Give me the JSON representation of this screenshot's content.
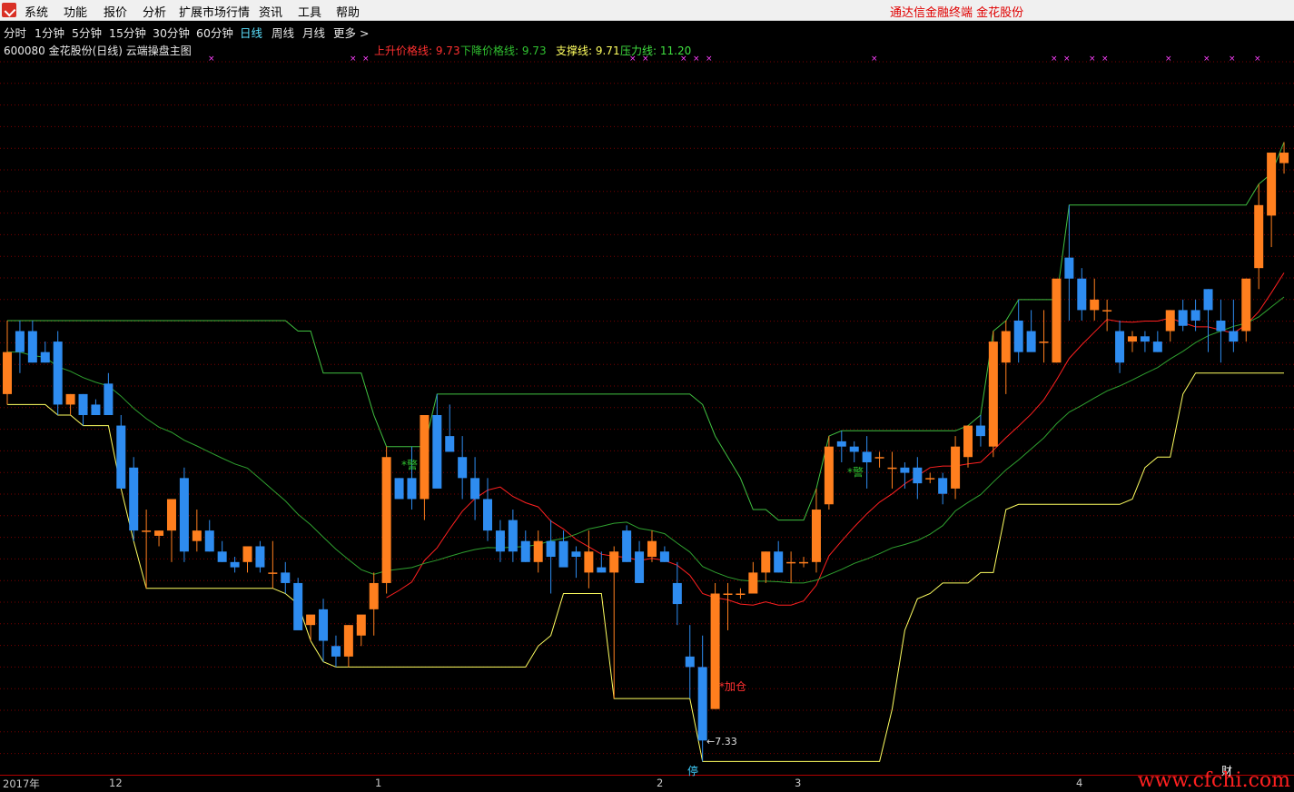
{
  "menubar": {
    "items": [
      "系统",
      "功能",
      "报价",
      "分析",
      "扩展市场行情",
      "资讯",
      "工具",
      "帮助"
    ],
    "brand": "通达信金融终端   金花股份"
  },
  "timeframes": {
    "items": [
      "分时",
      "1分钟",
      "5分钟",
      "15分钟",
      "30分钟",
      "60分钟",
      "日线",
      "周线",
      "月线",
      "更多 >"
    ],
    "active_index": 6
  },
  "info": {
    "title": "600080 金花股份(日线) 云端操盘主图",
    "up_label": "上升价格线: 9.73",
    "down_label": "下降价格线: 9.73",
    "support_label": "支撑线: 9.71",
    "pressure_label": "压力线: 11.20"
  },
  "annotations": {
    "warn1": "*警",
    "warn2": "*警",
    "add_position": "*加仓",
    "low_price": "←7.33",
    "limit_marker": "停",
    "fin_marker": "财"
  },
  "axis_labels": [
    "2017年",
    "12",
    "1",
    "2",
    "3",
    "4"
  ],
  "watermark": "www.cfchi.com",
  "colors": {
    "up_candle": "#ff7f1e",
    "down_candle": "#2e8cf0",
    "support_line": "#ffff60",
    "pressure_line": "#40c040",
    "ma_red": "#ff2020",
    "grid": "#7a0000"
  },
  "chart_data": {
    "type": "candlestick",
    "price_range": [
      7.0,
      13.0
    ],
    "candles": [
      {
        "o": 9.8,
        "h": 10.5,
        "l": 9.7,
        "c": 10.2
      },
      {
        "o": 10.4,
        "h": 10.5,
        "l": 10.0,
        "c": 10.2
      },
      {
        "o": 10.4,
        "h": 10.5,
        "l": 10.1,
        "c": 10.1
      },
      {
        "o": 10.2,
        "h": 10.3,
        "l": 10.1,
        "c": 10.1
      },
      {
        "o": 10.3,
        "h": 10.4,
        "l": 9.6,
        "c": 9.7
      },
      {
        "o": 9.7,
        "h": 9.8,
        "l": 9.6,
        "c": 9.8
      },
      {
        "o": 9.8,
        "h": 9.8,
        "l": 9.5,
        "c": 9.6
      },
      {
        "o": 9.7,
        "h": 9.75,
        "l": 9.6,
        "c": 9.6
      },
      {
        "o": 9.9,
        "h": 10.0,
        "l": 9.6,
        "c": 9.6
      },
      {
        "o": 9.5,
        "h": 9.6,
        "l": 8.9,
        "c": 8.9
      },
      {
        "o": 9.1,
        "h": 9.2,
        "l": 8.4,
        "c": 8.5
      },
      {
        "o": 8.5,
        "h": 8.7,
        "l": 7.95,
        "c": 8.5
      },
      {
        "o": 8.45,
        "h": 8.5,
        "l": 8.35,
        "c": 8.5
      },
      {
        "o": 8.5,
        "h": 8.7,
        "l": 8.2,
        "c": 8.8
      },
      {
        "o": 9.0,
        "h": 9.1,
        "l": 8.2,
        "c": 8.3
      },
      {
        "o": 8.4,
        "h": 8.7,
        "l": 8.3,
        "c": 8.5
      },
      {
        "o": 8.5,
        "h": 8.6,
        "l": 8.3,
        "c": 8.3
      },
      {
        "o": 8.3,
        "h": 8.4,
        "l": 8.2,
        "c": 8.2
      },
      {
        "o": 8.2,
        "h": 8.25,
        "l": 8.1,
        "c": 8.15
      },
      {
        "o": 8.2,
        "h": 8.35,
        "l": 8.1,
        "c": 8.35
      },
      {
        "o": 8.35,
        "h": 8.4,
        "l": 8.1,
        "c": 8.15
      },
      {
        "o": 8.1,
        "h": 8.4,
        "l": 7.95,
        "c": 8.1
      },
      {
        "o": 8.1,
        "h": 8.2,
        "l": 7.9,
        "c": 8.0
      },
      {
        "o": 8.0,
        "h": 8.05,
        "l": 7.8,
        "c": 7.55
      },
      {
        "o": 7.6,
        "h": 7.65,
        "l": 7.45,
        "c": 7.7
      },
      {
        "o": 7.75,
        "h": 7.85,
        "l": 7.25,
        "c": 7.45
      },
      {
        "o": 7.4,
        "h": 7.5,
        "l": 7.2,
        "c": 7.3
      },
      {
        "o": 7.3,
        "h": 7.6,
        "l": 7.2,
        "c": 7.6
      },
      {
        "o": 7.5,
        "h": 7.65,
        "l": 7.4,
        "c": 7.7
      },
      {
        "o": 7.75,
        "h": 8.1,
        "l": 7.5,
        "c": 8.0
      },
      {
        "o": 8.0,
        "h": 9.3,
        "l": 7.9,
        "c": 9.2
      },
      {
        "o": 9.0,
        "h": 9.0,
        "l": 8.8,
        "c": 8.8
      },
      {
        "o": 9.0,
        "h": 9.3,
        "l": 8.7,
        "c": 8.8
      },
      {
        "o": 8.8,
        "h": 9.0,
        "l": 8.6,
        "c": 9.6
      },
      {
        "o": 9.6,
        "h": 9.8,
        "l": 9.0,
        "c": 8.9
      },
      {
        "o": 9.4,
        "h": 9.7,
        "l": 9.3,
        "c": 9.25
      },
      {
        "o": 9.2,
        "h": 9.4,
        "l": 8.8,
        "c": 9.0
      },
      {
        "o": 9.0,
        "h": 9.2,
        "l": 8.6,
        "c": 8.8
      },
      {
        "o": 8.8,
        "h": 9.0,
        "l": 8.4,
        "c": 8.5
      },
      {
        "o": 8.5,
        "h": 8.6,
        "l": 8.2,
        "c": 8.3
      },
      {
        "o": 8.6,
        "h": 8.7,
        "l": 8.2,
        "c": 8.3
      },
      {
        "o": 8.4,
        "h": 8.5,
        "l": 8.2,
        "c": 8.2
      },
      {
        "o": 8.2,
        "h": 8.5,
        "l": 8.1,
        "c": 8.4
      },
      {
        "o": 8.4,
        "h": 8.6,
        "l": 7.9,
        "c": 8.25
      },
      {
        "o": 8.4,
        "h": 8.5,
        "l": 8.2,
        "c": 8.15
      },
      {
        "o": 8.3,
        "h": 8.35,
        "l": 8.05,
        "c": 8.25
      },
      {
        "o": 8.1,
        "h": 8.5,
        "l": 7.95,
        "c": 8.3
      },
      {
        "o": 8.15,
        "h": 8.3,
        "l": 8.1,
        "c": 8.1
      },
      {
        "o": 8.1,
        "h": 8.35,
        "l": 6.9,
        "c": 8.3
      },
      {
        "o": 8.5,
        "h": 8.55,
        "l": 8.2,
        "c": 8.2
      },
      {
        "o": 8.3,
        "h": 8.4,
        "l": 8.0,
        "c": 8.0
      },
      {
        "o": 8.25,
        "h": 8.5,
        "l": 8.2,
        "c": 8.4
      },
      {
        "o": 8.3,
        "h": 8.35,
        "l": 8.2,
        "c": 8.2
      },
      {
        "o": 8.0,
        "h": 8.2,
        "l": 7.6,
        "c": 7.8
      },
      {
        "o": 7.3,
        "h": 7.6,
        "l": 6.9,
        "c": 7.2
      },
      {
        "o": 7.2,
        "h": 7.5,
        "l": 6.3,
        "c": 6.5
      },
      {
        "o": 6.8,
        "h": 8.0,
        "l": 6.8,
        "c": 7.9
      },
      {
        "o": 7.9,
        "h": 8.0,
        "l": 7.55,
        "c": 7.9
      },
      {
        "o": 7.9,
        "h": 7.95,
        "l": 7.85,
        "c": 7.9
      },
      {
        "o": 7.9,
        "h": 8.2,
        "l": 7.9,
        "c": 8.1
      },
      {
        "o": 8.1,
        "h": 8.3,
        "l": 8.0,
        "c": 8.3
      },
      {
        "o": 8.3,
        "h": 8.4,
        "l": 8.1,
        "c": 8.1
      },
      {
        "o": 8.2,
        "h": 8.3,
        "l": 8.0,
        "c": 8.2
      },
      {
        "o": 8.2,
        "h": 8.25,
        "l": 8.15,
        "c": 8.2
      },
      {
        "o": 8.2,
        "h": 8.9,
        "l": 8.1,
        "c": 8.7
      },
      {
        "o": 8.75,
        "h": 9.4,
        "l": 8.7,
        "c": 9.3
      },
      {
        "o": 9.35,
        "h": 9.45,
        "l": 9.15,
        "c": 9.3
      },
      {
        "o": 9.3,
        "h": 9.35,
        "l": 9.15,
        "c": 9.25
      },
      {
        "o": 9.25,
        "h": 9.4,
        "l": 8.9,
        "c": 9.15
      },
      {
        "o": 9.2,
        "h": 9.25,
        "l": 9.1,
        "c": 9.2
      },
      {
        "o": 9.1,
        "h": 9.25,
        "l": 8.9,
        "c": 9.1
      },
      {
        "o": 9.1,
        "h": 9.15,
        "l": 8.9,
        "c": 9.05
      },
      {
        "o": 9.1,
        "h": 9.2,
        "l": 8.8,
        "c": 8.95
      },
      {
        "o": 9.0,
        "h": 9.05,
        "l": 8.95,
        "c": 9.0
      },
      {
        "o": 9.0,
        "h": 9.05,
        "l": 8.75,
        "c": 8.85
      },
      {
        "o": 8.9,
        "h": 9.4,
        "l": 8.8,
        "c": 9.3
      },
      {
        "o": 9.2,
        "h": 9.5,
        "l": 9.1,
        "c": 9.5
      },
      {
        "o": 9.5,
        "h": 9.6,
        "l": 9.3,
        "c": 9.4
      },
      {
        "o": 9.3,
        "h": 10.4,
        "l": 9.2,
        "c": 10.3
      },
      {
        "o": 10.1,
        "h": 10.5,
        "l": 9.8,
        "c": 10.4
      },
      {
        "o": 10.5,
        "h": 10.7,
        "l": 10.1,
        "c": 10.2
      },
      {
        "o": 10.4,
        "h": 10.6,
        "l": 10.3,
        "c": 10.2
      },
      {
        "o": 10.3,
        "h": 10.6,
        "l": 10.1,
        "c": 10.3
      },
      {
        "o": 10.1,
        "h": 10.7,
        "l": 10.1,
        "c": 10.9
      },
      {
        "o": 11.1,
        "h": 11.6,
        "l": 10.5,
        "c": 10.9
      },
      {
        "o": 10.9,
        "h": 11.0,
        "l": 10.5,
        "c": 10.6
      },
      {
        "o": 10.6,
        "h": 10.9,
        "l": 10.5,
        "c": 10.7
      },
      {
        "o": 10.6,
        "h": 10.7,
        "l": 10.4,
        "c": 10.6
      },
      {
        "o": 10.4,
        "h": 10.5,
        "l": 10.0,
        "c": 10.1
      },
      {
        "o": 10.3,
        "h": 10.4,
        "l": 10.2,
        "c": 10.35
      },
      {
        "o": 10.35,
        "h": 10.4,
        "l": 10.2,
        "c": 10.3
      },
      {
        "o": 10.3,
        "h": 10.4,
        "l": 10.2,
        "c": 10.2
      },
      {
        "o": 10.4,
        "h": 10.6,
        "l": 10.3,
        "c": 10.6
      },
      {
        "o": 10.6,
        "h": 10.7,
        "l": 10.4,
        "c": 10.45
      },
      {
        "o": 10.6,
        "h": 10.7,
        "l": 10.4,
        "c": 10.5
      },
      {
        "o": 10.8,
        "h": 10.8,
        "l": 10.2,
        "c": 10.6
      },
      {
        "o": 10.5,
        "h": 10.7,
        "l": 10.1,
        "c": 10.4
      },
      {
        "o": 10.4,
        "h": 10.7,
        "l": 10.2,
        "c": 10.3
      },
      {
        "o": 10.4,
        "h": 10.9,
        "l": 10.3,
        "c": 10.9
      },
      {
        "o": 11.0,
        "h": 11.8,
        "l": 10.8,
        "c": 11.6
      },
      {
        "o": 11.5,
        "h": 11.9,
        "l": 11.2,
        "c": 12.1
      },
      {
        "o": 12.0,
        "h": 12.2,
        "l": 11.9,
        "c": 12.1
      }
    ],
    "series": [
      {
        "name": "上升价格线",
        "values": [
          9.73
        ]
      },
      {
        "name": "下降价格线",
        "values": [
          9.73
        ]
      },
      {
        "name": "支撑线",
        "values": [
          9.71
        ]
      },
      {
        "name": "压力线",
        "values": [
          11.2
        ]
      }
    ]
  }
}
